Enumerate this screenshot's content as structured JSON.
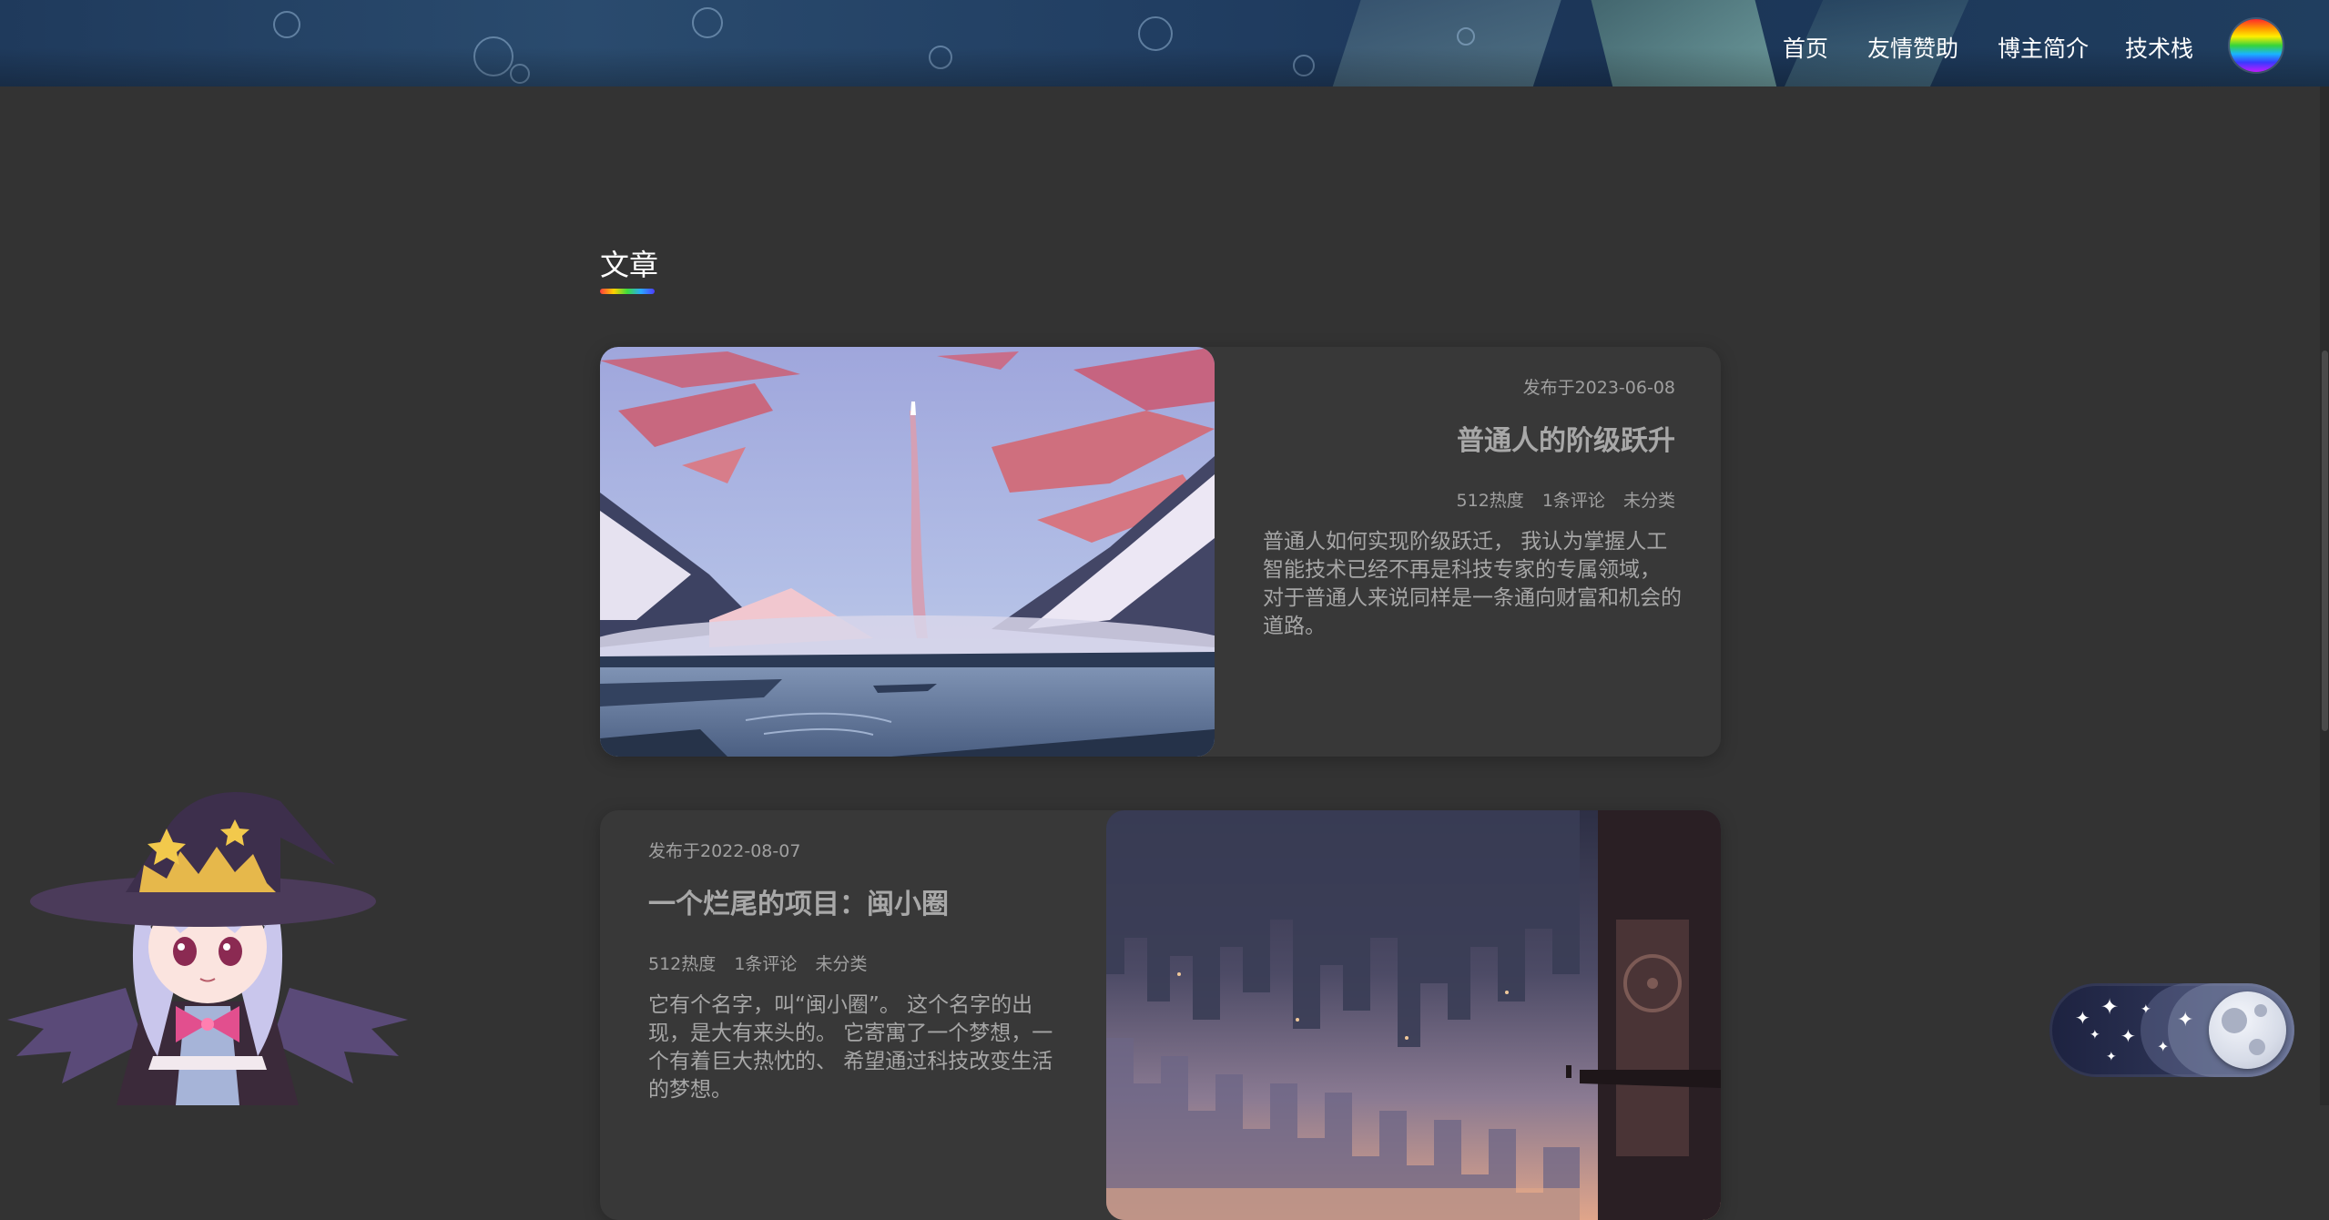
{
  "nav": {
    "home": "首页",
    "links": "友情赞助",
    "about": "博主简介",
    "stack": "技术栈"
  },
  "section": {
    "title": "文章"
  },
  "posts": [
    {
      "date": "发布于2023-06-08",
      "title": "普通人的阶级跃升",
      "heat": "512热度",
      "comments": "1条评论",
      "category": "未分类",
      "excerpt": "普通人如何实现阶级跃迁， 我认为掌握人工智能技术已经不再是科技专家的专属领域， 对于普通人来说同样是一条通向财富和机会的道路。"
    },
    {
      "date": "发布于2022-08-07",
      "title": "一个烂尾的项目：闽小圈",
      "heat": "512热度",
      "comments": "1条评论",
      "category": "未分类",
      "excerpt": "它有个名字，叫“闽小圈”。 这个名字的出现，是大有来头的。 它寄寓了一个梦想，一个有着巨大热忱的、 希望通过科技改变生活的梦想。"
    }
  ],
  "colors": {
    "page_bg": "#333333",
    "card_bg": "#383838",
    "header_bg": "#203e5f",
    "text_muted": "#a0a0a0"
  },
  "icons": {
    "avatar": "rainbow-circle-avatar",
    "theme_toggle": "moon-stars-toggle",
    "mascot": "witch-girl-mascot"
  }
}
